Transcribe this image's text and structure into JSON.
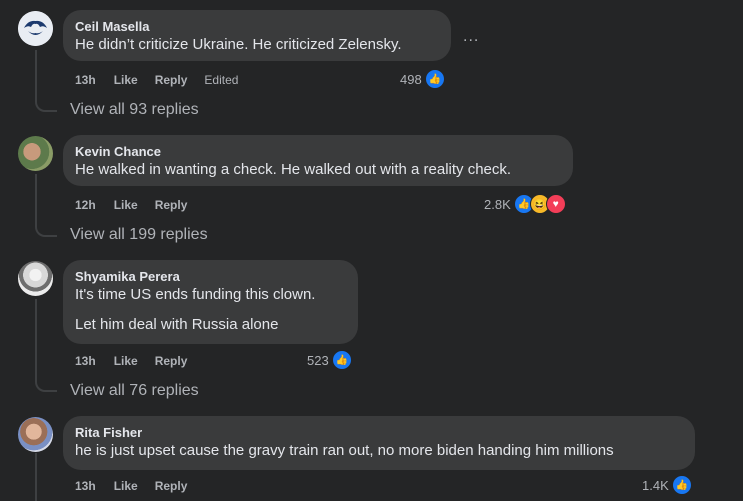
{
  "comments": [
    {
      "author": "Ceil Masella",
      "lines": [
        "He didn’t criticize Ukraine. He criticized Zelensky."
      ],
      "time": "13h",
      "like_label": "Like",
      "reply_label": "Reply",
      "edited_label": "Edited",
      "reaction_count": "498",
      "view_replies": "View all 93 replies",
      "avatar_icon": "penn-state-logo-icon"
    },
    {
      "author": "Kevin Chance",
      "lines": [
        "He walked in wanting a check. He walked out with a reality check."
      ],
      "time": "12h",
      "like_label": "Like",
      "reply_label": "Reply",
      "reaction_count": "2.8K",
      "view_replies": "View all 199 replies"
    },
    {
      "author": "Shyamika Perera",
      "lines": [
        "It's time US ends funding this clown.",
        "Let him deal with Russia alone"
      ],
      "time": "13h",
      "like_label": "Like",
      "reply_label": "Reply",
      "reaction_count": "523",
      "view_replies": "View all 76 replies"
    },
    {
      "author": "Rita Fisher",
      "lines": [
        "he is just upset cause the gravy train ran out, no more biden handing him millions"
      ],
      "time": "13h",
      "like_label": "Like",
      "reply_label": "Reply",
      "reaction_count": "1.4K"
    }
  ],
  "more_options": "...",
  "colors": {
    "background": "#242526",
    "bubble": "#3a3b3c",
    "like": "#1877f2",
    "love": "#f33e58",
    "haha": "#f7b928"
  }
}
